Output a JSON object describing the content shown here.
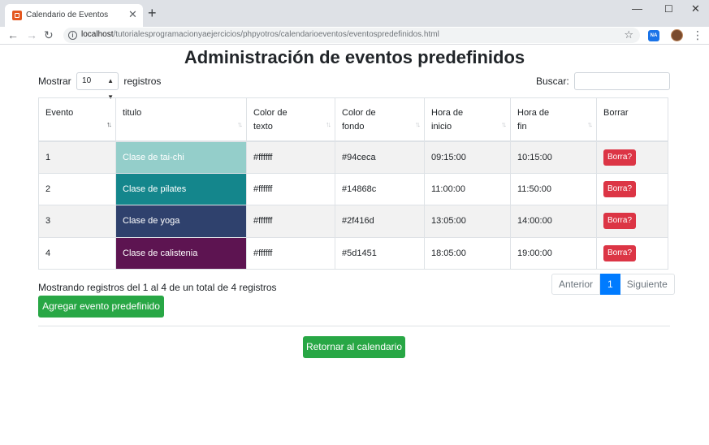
{
  "browser": {
    "tab_title": "Calendario de Eventos",
    "tab_close": "✕",
    "new_tab": "+",
    "url_host": "localhost",
    "url_path": "/tutorialesprogramacionyaejercicios/phpyotros/calendarioeventos/eventospredefinidos.html",
    "info_glyph": "i",
    "ext_badge": "NA"
  },
  "page": {
    "title": "Administración de eventos predefinidos",
    "length_label_pre": "Mostrar",
    "length_value": "10",
    "length_label_post": "registros",
    "search_label": "Buscar:",
    "search_value": ""
  },
  "table": {
    "headers": {
      "evento": "Evento",
      "titulo": "titulo",
      "color_texto_1": "Color de",
      "color_texto_2": "texto",
      "color_fondo_1": "Color de",
      "color_fondo_2": "fondo",
      "hora_inicio_1": "Hora de",
      "hora_inicio_2": "inicio",
      "hora_fin_1": "Hora de",
      "hora_fin_2": "fin",
      "borrar": "Borrar"
    },
    "rows": [
      {
        "id": "1",
        "titulo": "Clase de tai-chi",
        "color_texto": "#ffffff",
        "color_fondo": "#94ceca",
        "hora_inicio": "09:15:00",
        "hora_fin": "10:15:00",
        "borrar": "Borra?"
      },
      {
        "id": "2",
        "titulo": "Clase de pilates",
        "color_texto": "#ffffff",
        "color_fondo": "#14868c",
        "hora_inicio": "11:00:00",
        "hora_fin": "11:50:00",
        "borrar": "Borra?"
      },
      {
        "id": "3",
        "titulo": "Clase de yoga",
        "color_texto": "#ffffff",
        "color_fondo": "#2f416d",
        "hora_inicio": "13:05:00",
        "hora_fin": "14:00:00",
        "borrar": "Borra?"
      },
      {
        "id": "4",
        "titulo": "Clase de calistenia",
        "color_texto": "#ffffff",
        "color_fondo": "#5d1451",
        "hora_inicio": "18:05:00",
        "hora_fin": "19:00:00",
        "borrar": "Borra?"
      }
    ]
  },
  "footer": {
    "info": "Mostrando registros del 1 al 4 de un total de 4 registros",
    "prev": "Anterior",
    "current_page": "1",
    "next": "Siguiente",
    "add_button": "Agregar evento predefinido",
    "return_button": "Retornar al calendario"
  },
  "colors": {
    "primary": "#007bff",
    "success": "#28a745",
    "danger": "#dc3545"
  }
}
